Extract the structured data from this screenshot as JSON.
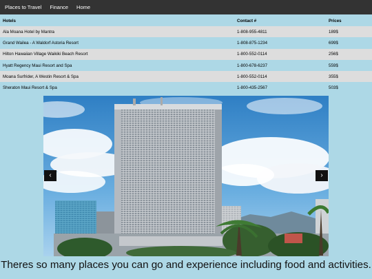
{
  "nav": {
    "items": [
      "Places to Travel",
      "Finance",
      "Home"
    ]
  },
  "table": {
    "headers": [
      "Hotels",
      "Contact #",
      "Prices"
    ],
    "rows": [
      [
        "Ala Moana Hotel by Mantra",
        "1-808-955-4811",
        "189$"
      ],
      [
        "Grand Wailea - A Waldorf Astoria Resort",
        "1-808-875-1234",
        "699$"
      ],
      [
        "Hilton Hawaiian Village Waikiki Beach Resort",
        "1-800-552-0114",
        "256$"
      ],
      [
        "Hyatt Regency Maui Resort and Spa",
        "1-800-678-6237",
        "559$"
      ],
      [
        "Moana Surfrider, A Westin Resort & Spa",
        "1-800-552-0114",
        "355$"
      ],
      [
        "Sheraton Maui Resort & Spa",
        "1-800-435-2567",
        "503$"
      ]
    ]
  },
  "carousel": {
    "prev_icon": "chevron-left-icon",
    "next_icon": "chevron-right-icon",
    "prev_glyph": "‹",
    "next_glyph": "›"
  },
  "caption": "Theres so many places you can go and experience including food and activities.",
  "colors": {
    "navbar": "#333333",
    "page_background": "#add8e6",
    "row_alt": "#dddddd"
  }
}
